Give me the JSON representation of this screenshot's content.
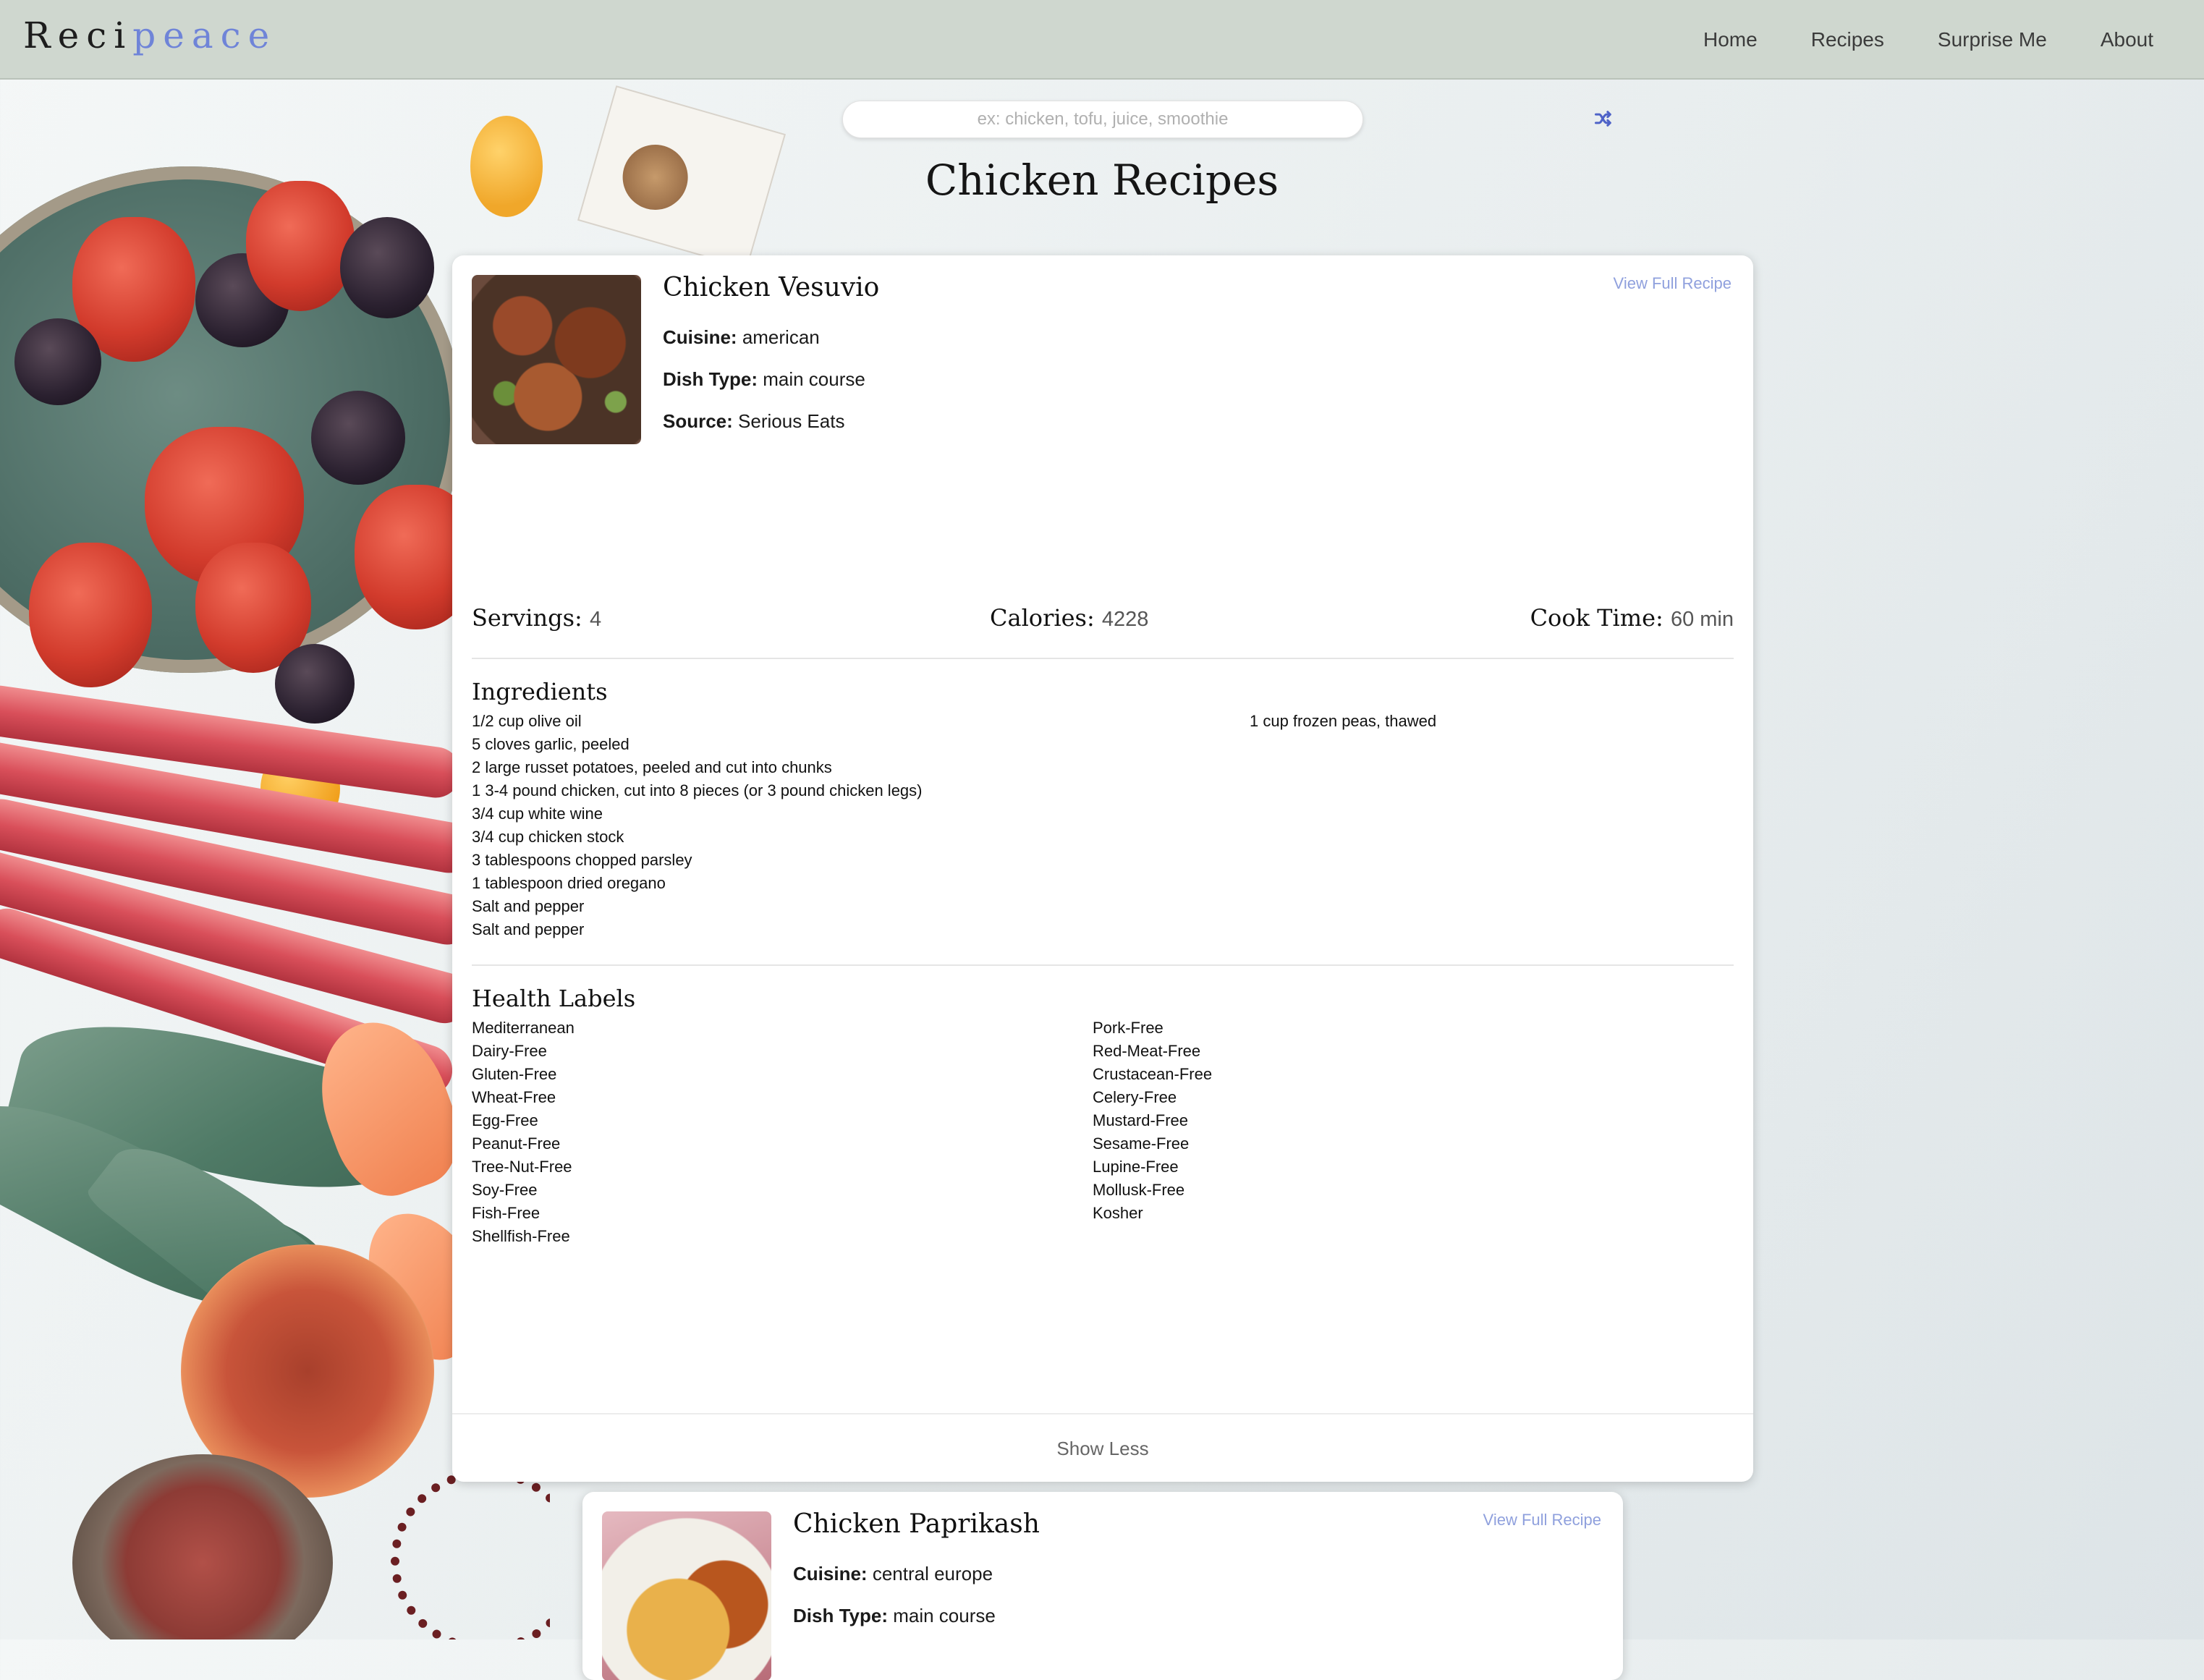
{
  "navbar": {
    "brand_prefix": "Reci",
    "brand_suffix": "peace",
    "links": [
      "Home",
      "Recipes",
      "Surprise Me",
      "About"
    ]
  },
  "search": {
    "placeholder": "ex: chicken, tofu, juice, smoothie",
    "value": ""
  },
  "shuffle_icon": "shuffle-icon",
  "page_title": "Chicken Recipes",
  "recipes": [
    {
      "title": "Chicken Vesuvio",
      "view_link": "View Full Recipe",
      "cuisine_label": "Cuisine:",
      "cuisine": "american",
      "dish_type_label": "Dish Type:",
      "dish_type": "main course",
      "source_label": "Source:",
      "source": "Serious Eats",
      "servings_label": "Servings:",
      "servings": "4",
      "calories_label": "Calories:",
      "calories": "4228",
      "cook_time_label": "Cook Time:",
      "cook_time": "60 min",
      "ingredients_title": "Ingredients",
      "ingredients_col1": [
        "1/2 cup olive oil",
        "5 cloves garlic, peeled",
        "2 large russet potatoes, peeled and cut into chunks",
        "1 3-4 pound chicken, cut into 8 pieces (or 3 pound chicken legs)",
        "3/4 cup white wine",
        "3/4 cup chicken stock",
        "3 tablespoons chopped parsley",
        "1 tablespoon dried oregano",
        "Salt and pepper",
        "Salt and pepper"
      ],
      "ingredients_col2": [
        "1 cup frozen peas, thawed"
      ],
      "health_title": "Health Labels",
      "health_col1": [
        "Mediterranean",
        "Dairy-Free",
        "Gluten-Free",
        "Wheat-Free",
        "Egg-Free",
        "Peanut-Free",
        "Tree-Nut-Free",
        "Soy-Free",
        "Fish-Free",
        "Shellfish-Free"
      ],
      "health_col2": [
        "Pork-Free",
        "Red-Meat-Free",
        "Crustacean-Free",
        "Celery-Free",
        "Mustard-Free",
        "Sesame-Free",
        "Lupine-Free",
        "Mollusk-Free",
        "Kosher"
      ],
      "toggle_label": "Show Less"
    },
    {
      "title": "Chicken Paprikash",
      "view_link": "View Full Recipe",
      "cuisine_label": "Cuisine:",
      "cuisine": "central europe",
      "dish_type_label": "Dish Type:",
      "dish_type": "main course"
    }
  ],
  "colors": {
    "navbar_bg": "#cfd7cf",
    "brand_accent": "#6f84d8",
    "link_accent": "#8fa0dd",
    "card_bg": "#ffffff"
  }
}
